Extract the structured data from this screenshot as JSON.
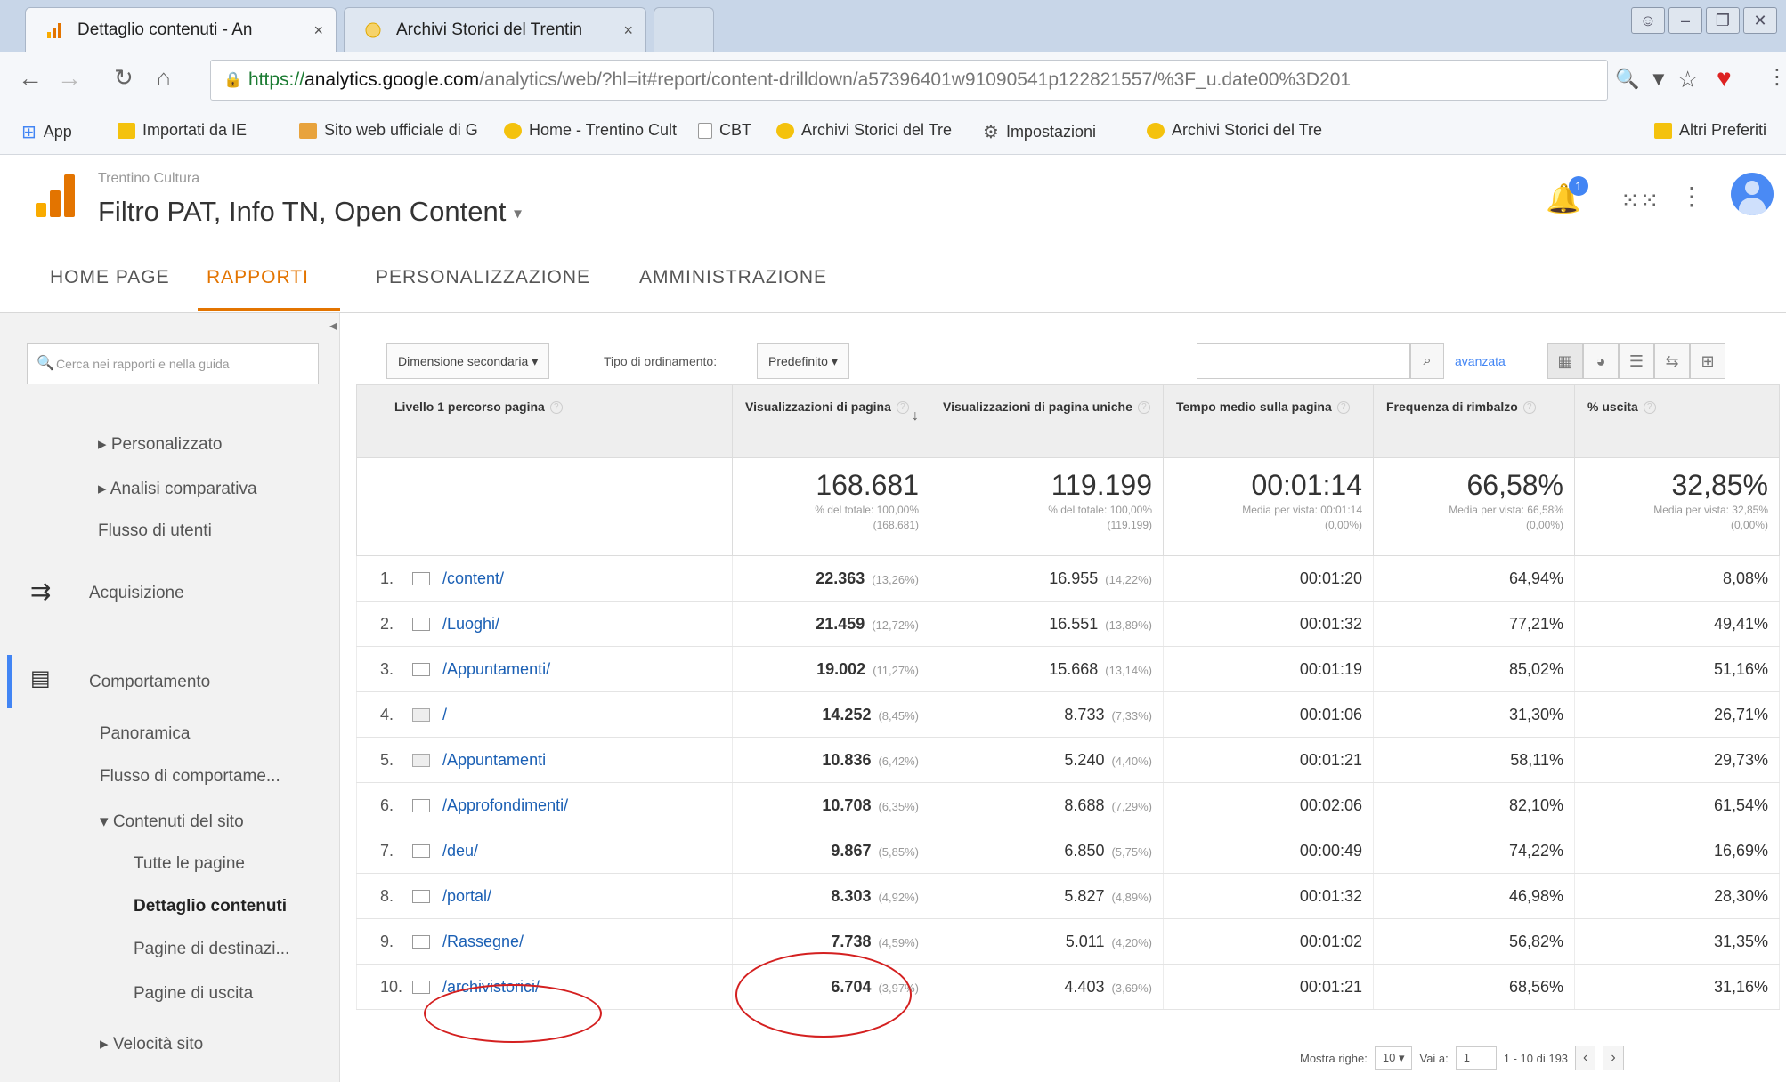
{
  "browser": {
    "tabs": [
      {
        "title": "Dettaglio contenuti - An",
        "close": "×"
      },
      {
        "title": "Archivi Storici del Trentin",
        "close": "×"
      }
    ],
    "url": {
      "protocol": "https://",
      "host": "analytics.google.com",
      "path": "/analytics/web/?hl=it#report/content-drilldown/a57396401w91090541p122821557/%3F_u.date00%3D201"
    },
    "bookmarks": [
      {
        "label": "App",
        "color": "#4285f4"
      },
      {
        "label": "Importati da IE",
        "color": "#f4c20d"
      },
      {
        "label": "Sito web ufficiale di G",
        "color": "#e8a33d"
      },
      {
        "label": "Home - Trentino Cult",
        "color": "#f4c20d"
      },
      {
        "label": "CBT",
        "color": "#cccccc"
      },
      {
        "label": "Archivi Storici del Tre",
        "color": "#f4c20d"
      },
      {
        "label": "Impostazioni",
        "color": "#555555"
      },
      {
        "label": "Archivi Storici del Tre",
        "color": "#f4c20d"
      }
    ],
    "other_bookmarks": "Altri Preferiti"
  },
  "ga": {
    "account": "Trentino Cultura",
    "property": "Filtro PAT, Info TN, Open Content",
    "property_caret": "▾",
    "notification_count": "1",
    "nav": [
      {
        "label": "HOME PAGE"
      },
      {
        "label": "RAPPORTI"
      },
      {
        "label": "PERSONALIZZAZIONE"
      },
      {
        "label": "AMMINISTRAZIONE"
      }
    ],
    "brand_color": "#e37400"
  },
  "sidebar": {
    "search_placeholder": "Cerca nei rapporti e nella guida",
    "items": {
      "personalizzato": "▸ Personalizzato",
      "analisi": "▸ Analisi comparativa",
      "flusso_utenti": "Flusso di utenti",
      "acquisizione": "Acquisizione",
      "comportamento": "Comportamento",
      "panoramica": "Panoramica",
      "flusso_comp": "Flusso di comportame...",
      "contenuti": "▾ Contenuti del sito",
      "tutte": "Tutte le pagine",
      "dettaglio": "Dettaglio contenuti",
      "destinazione": "Pagine di destinazi...",
      "uscita": "Pagine di uscita",
      "velocita": "▸ Velocità sito"
    }
  },
  "toolbar": {
    "secondary_dimension": "Dimensione secondaria ▾",
    "sort_label": "Tipo di ordinamento:",
    "sort_value": "Predefinito ▾",
    "advanced": "avanzata"
  },
  "table": {
    "headers": {
      "dim": "Livello 1 percorso pagina",
      "pv": "Visualizzazioni di pagina",
      "upv": "Visualizzazioni di pagina uniche",
      "time": "Tempo medio sulla pagina",
      "bounce": "Frequenza di rimbalzo",
      "exit": "% uscita"
    },
    "totals": {
      "pv": {
        "big": "168.681",
        "sub1": "% del totale: 100,00%",
        "sub2": "(168.681)"
      },
      "upv": {
        "big": "119.199",
        "sub1": "% del totale: 100,00%",
        "sub2": "(119.199)"
      },
      "time": {
        "big": "00:01:14",
        "sub1": "Media per vista: 00:01:14",
        "sub2": "(0,00%)"
      },
      "bounce": {
        "big": "66,58%",
        "sub1": "Media per vista: 66,58%",
        "sub2": "(0,00%)"
      },
      "exit": {
        "big": "32,85%",
        "sub1": "Media per vista: 32,85%",
        "sub2": "(0,00%)"
      }
    },
    "rows": [
      {
        "n": "1.",
        "path": "/content/",
        "pv": "22.363",
        "pvp": "(13,26%)",
        "upv": "16.955",
        "upvp": "(14,22%)",
        "time": "00:01:20",
        "bounce": "64,94%",
        "exit": "8,08%",
        "page": false
      },
      {
        "n": "2.",
        "path": "/Luoghi/",
        "pv": "21.459",
        "pvp": "(12,72%)",
        "upv": "16.551",
        "upvp": "(13,89%)",
        "time": "00:01:32",
        "bounce": "77,21%",
        "exit": "49,41%",
        "page": false
      },
      {
        "n": "3.",
        "path": "/Appuntamenti/",
        "pv": "19.002",
        "pvp": "(11,27%)",
        "upv": "15.668",
        "upvp": "(13,14%)",
        "time": "00:01:19",
        "bounce": "85,02%",
        "exit": "51,16%",
        "page": false
      },
      {
        "n": "4.",
        "path": "/",
        "pv": "14.252",
        "pvp": "(8,45%)",
        "upv": "8.733",
        "upvp": "(7,33%)",
        "time": "00:01:06",
        "bounce": "31,30%",
        "exit": "26,71%",
        "page": true
      },
      {
        "n": "5.",
        "path": "/Appuntamenti",
        "pv": "10.836",
        "pvp": "(6,42%)",
        "upv": "5.240",
        "upvp": "(4,40%)",
        "time": "00:01:21",
        "bounce": "58,11%",
        "exit": "29,73%",
        "page": true
      },
      {
        "n": "6.",
        "path": "/Approfondimenti/",
        "pv": "10.708",
        "pvp": "(6,35%)",
        "upv": "8.688",
        "upvp": "(7,29%)",
        "time": "00:02:06",
        "bounce": "82,10%",
        "exit": "61,54%",
        "page": false
      },
      {
        "n": "7.",
        "path": "/deu/",
        "pv": "9.867",
        "pvp": "(5,85%)",
        "upv": "6.850",
        "upvp": "(5,75%)",
        "time": "00:00:49",
        "bounce": "74,22%",
        "exit": "16,69%",
        "page": false
      },
      {
        "n": "8.",
        "path": "/portal/",
        "pv": "8.303",
        "pvp": "(4,92%)",
        "upv": "5.827",
        "upvp": "(4,89%)",
        "time": "00:01:32",
        "bounce": "46,98%",
        "exit": "28,30%",
        "page": false
      },
      {
        "n": "9.",
        "path": "/Rassegne/",
        "pv": "7.738",
        "pvp": "(4,59%)",
        "upv": "5.011",
        "upvp": "(4,20%)",
        "time": "00:01:02",
        "bounce": "56,82%",
        "exit": "31,35%",
        "page": false
      },
      {
        "n": "10.",
        "path": "/archivistorici/",
        "pv": "6.704",
        "pvp": "(3,97%)",
        "upv": "4.403",
        "upvp": "(3,69%)",
        "time": "00:01:21",
        "bounce": "68,56%",
        "exit": "31,16%",
        "page": false
      }
    ]
  },
  "pager": {
    "rows_label": "Mostra righe:",
    "rows_value": "10 ▾",
    "goto_label": "Vai a:",
    "goto_value": "1",
    "range": "1 - 10 di 193",
    "prev": "‹",
    "next": "›"
  }
}
